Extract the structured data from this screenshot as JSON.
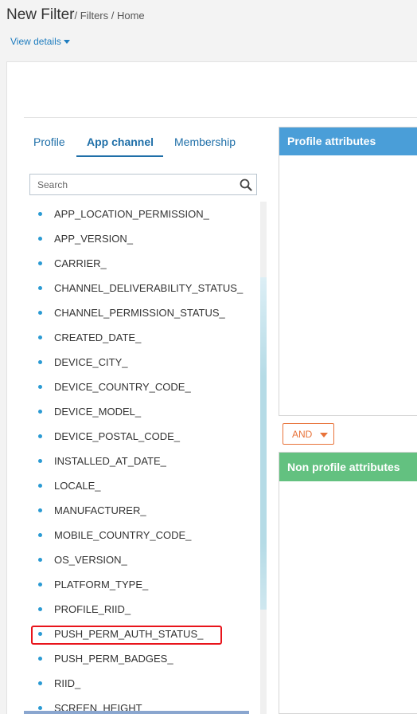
{
  "header": {
    "title": "New Filter",
    "breadcrumb": "/ Filters / Home",
    "view_details": "View details"
  },
  "tabs": [
    {
      "label": "Profile"
    },
    {
      "label": "App channel",
      "active": true
    },
    {
      "label": "Membership"
    }
  ],
  "search": {
    "placeholder": "Search"
  },
  "attributes": [
    "APP_LOCATION_PERMISSION_",
    "APP_VERSION_",
    "CARRIER_",
    "CHANNEL_DELIVERABILITY_STATUS_",
    "CHANNEL_PERMISSION_STATUS_",
    "CREATED_DATE_",
    "DEVICE_CITY_",
    "DEVICE_COUNTRY_CODE_",
    "DEVICE_MODEL_",
    "DEVICE_POSTAL_CODE_",
    "INSTALLED_AT_DATE_",
    "LOCALE_",
    "MANUFACTURER_",
    "MOBILE_COUNTRY_CODE_",
    "OS_VERSION_",
    "PLATFORM_TYPE_",
    "PROFILE_RIID_",
    "PUSH_PERM_AUTH_STATUS_",
    "PUSH_PERM_BADGES_",
    "RIID_",
    "SCREEN_HEIGHT"
  ],
  "highlighted_attribute": "PUSH_PERM_AUTH_STATUS_",
  "profile_attributes": {
    "title": "Profile attributes"
  },
  "logic": {
    "and_label": "AND"
  },
  "non_profile_attributes": {
    "title": "Non profile attributes"
  },
  "colors": {
    "accent_blue": "#1f6fa8",
    "profile_header": "#4a9ed8",
    "non_profile_header": "#63c180",
    "and_orange": "#e8733a",
    "highlight_red": "#e8141b"
  }
}
